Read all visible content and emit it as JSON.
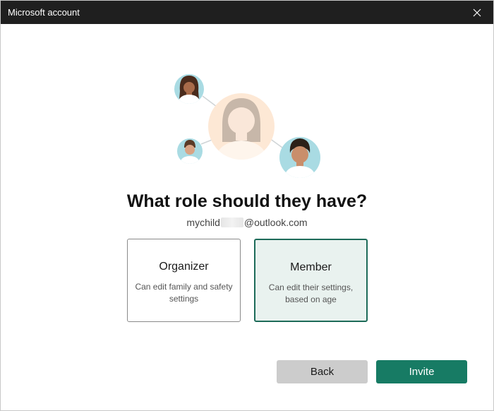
{
  "window": {
    "title": "Microsoft account",
    "close_icon": "close-icon"
  },
  "illustration": {
    "avatars": [
      "female-avatar-icon",
      "young-child-avatar-icon",
      "male-avatar-icon",
      "selected-person-avatar-icon"
    ]
  },
  "dialog": {
    "heading": "What role should they have?",
    "email_prefix": "mychild",
    "email_suffix": "@outlook.com"
  },
  "roles": [
    {
      "title": "Organizer",
      "description": "Can edit family and safety settings",
      "selected": false
    },
    {
      "title": "Member",
      "description": "Can edit their settings, based on age",
      "selected": true
    }
  ],
  "buttons": {
    "back_label": "Back",
    "invite_label": "Invite"
  },
  "colors": {
    "titlebar": "#1f1f1f",
    "accent": "#177b64",
    "selected_border": "#1d6b59",
    "selected_fill": "#e9f2ef",
    "secondary_button": "#cccccc"
  }
}
